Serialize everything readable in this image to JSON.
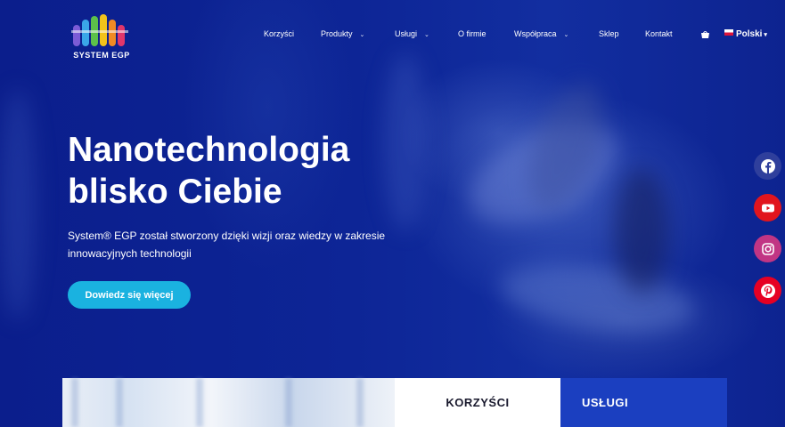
{
  "brand": {
    "name": "SYSTEM EGP"
  },
  "nav": {
    "items": [
      {
        "label": "Korzyści",
        "has_dropdown": false
      },
      {
        "label": "Produkty",
        "has_dropdown": true
      },
      {
        "label": "Usługi",
        "has_dropdown": true
      },
      {
        "label": "O firmie",
        "has_dropdown": false
      },
      {
        "label": "Współpraca",
        "has_dropdown": true
      },
      {
        "label": "Sklep",
        "has_dropdown": false
      },
      {
        "label": "Kontakt",
        "has_dropdown": false
      }
    ],
    "language": "Polski"
  },
  "hero": {
    "headline_line1": "Nanotechnologia",
    "headline_line2": "blisko Ciebie",
    "lead_line1": "System® EGP został stworzony dzięki wizji oraz wiedzy w zakresie",
    "lead_line2": "innowacyjnych technologii",
    "cta_label": "Dowiedz się więcej"
  },
  "social": [
    "facebook-icon",
    "youtube-icon",
    "instagram-icon",
    "pinterest-icon"
  ],
  "panel": {
    "tab1": "KORZYŚCI",
    "tab2": "USŁUGI"
  },
  "colors": {
    "hero_blue": "#0a1f8a",
    "accent_cyan": "#1ab2e0",
    "uslugi_blue": "#1b3fc0"
  }
}
